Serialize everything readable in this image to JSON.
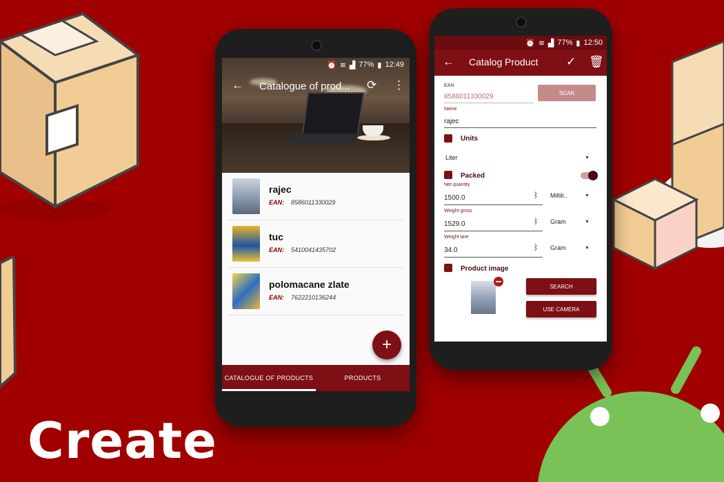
{
  "headline": "Create",
  "left_phone": {
    "status": {
      "battery": "77%",
      "time": "12:49"
    },
    "appbar": {
      "title": "Catalogue of prod..."
    },
    "products": [
      {
        "name": "rajec",
        "ean_label": "EAN:",
        "ean": "8586011330029"
      },
      {
        "name": "tuc",
        "ean_label": "EAN:",
        "ean": "5410041435702"
      },
      {
        "name": "polomacane zlate",
        "ean_label": "EAN:",
        "ean": "7622210136244"
      }
    ],
    "fab_label": "+",
    "tabs": [
      {
        "label": "CATALOGUE OF PRODUCTS",
        "active": true
      },
      {
        "label": "PRODUCTS",
        "active": false
      }
    ]
  },
  "right_phone": {
    "status": {
      "battery": "77%",
      "time": "12:50"
    },
    "appbar": {
      "title": "Catalog Product"
    },
    "ean": {
      "label": "EAN",
      "value": "8586011330029",
      "scan_label": "SCAN"
    },
    "name": {
      "label": "Name",
      "value": "rajec"
    },
    "units": {
      "title": "Units",
      "selected": "Liter"
    },
    "packed": {
      "title": "Packed",
      "on": true
    },
    "net_quantity": {
      "label": "Net quantity",
      "value": "1500.0",
      "unit": "Millili.."
    },
    "weight_gross": {
      "label": "Weight gross",
      "value": "1529.0",
      "unit": "Gram"
    },
    "weight_tare": {
      "label": "Weight tare",
      "value": "34.0",
      "unit": "Gram"
    },
    "product_image": {
      "title": "Product image",
      "search_label": "SEARCH",
      "camera_label": "USE CAMERA"
    }
  },
  "colors": {
    "background": "#a00000",
    "primary": "#7d0f15",
    "android_green": "#78c257"
  }
}
